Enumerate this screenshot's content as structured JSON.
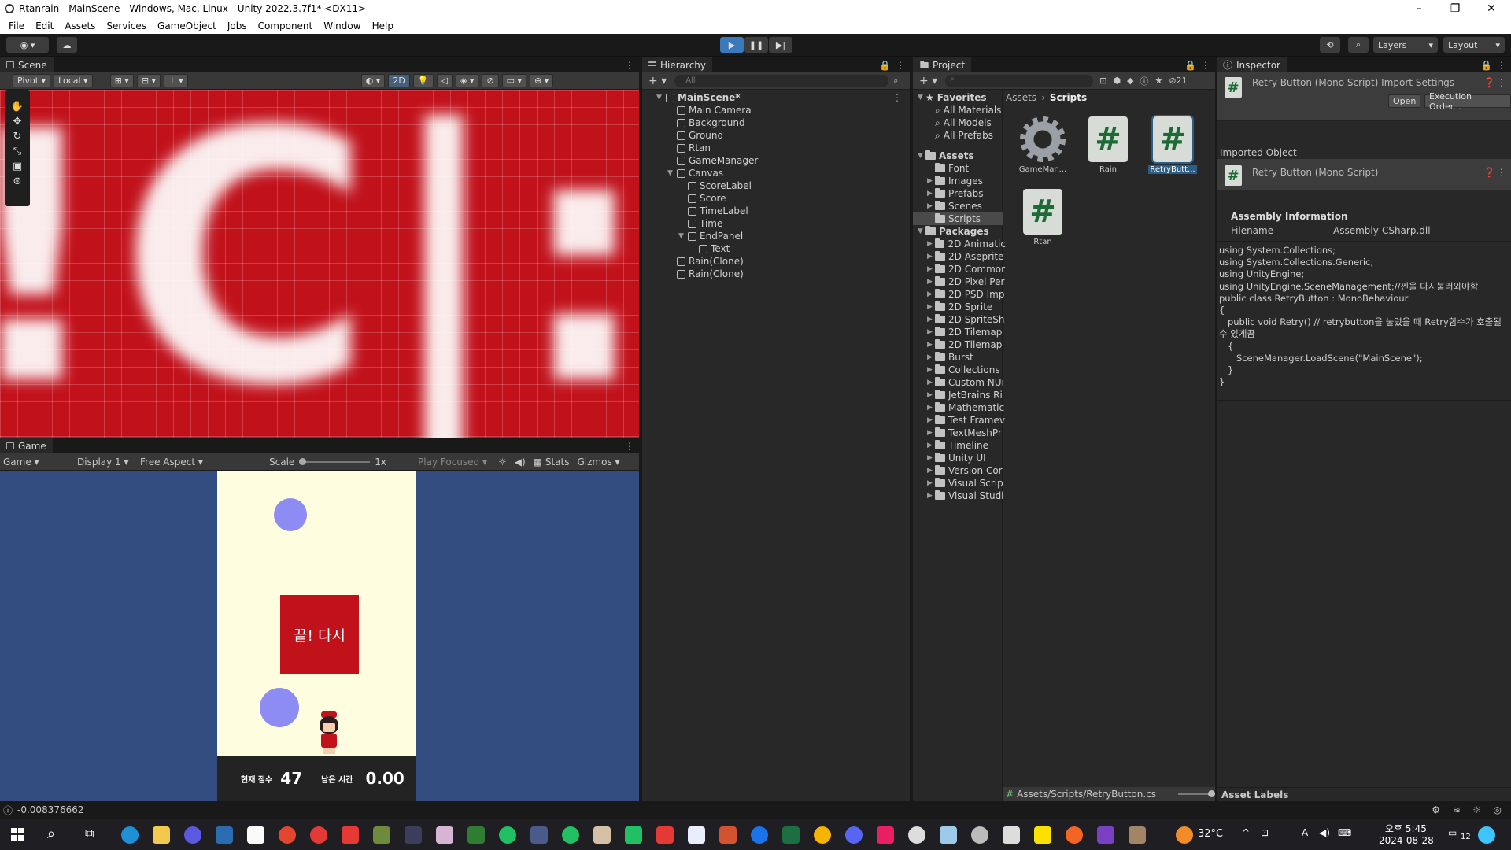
{
  "window": {
    "title": "Rtanrain - MainScene - Windows, Mac, Linux - Unity 2022.3.7f1* <DX11>"
  },
  "menu": [
    "File",
    "Edit",
    "Assets",
    "Services",
    "GameObject",
    "Jobs",
    "Component",
    "Window",
    "Help"
  ],
  "toolbar": {
    "layers_label": "Layers",
    "layout_label": "Layout"
  },
  "scene": {
    "tab": "Scene",
    "pivot": "Pivot",
    "local": "Local",
    "mode2d": "2D",
    "bg_color": "#c1121c",
    "big_text": "!C|:"
  },
  "game": {
    "tab": "Game",
    "display_mode": "Game",
    "display": "Display 1",
    "aspect": "Free Aspect",
    "scale_label": "Scale",
    "scale_value": "1x",
    "play_focused": "Play Focused",
    "stats": "Stats",
    "gizmos": "Gizmos",
    "end_button": "끝! 다시",
    "score_label": "현재 점수",
    "score": "47",
    "time_label": "남은 시간",
    "time": "0.00"
  },
  "hierarchy": {
    "tab": "Hierarchy",
    "search_placeholder": "All",
    "items": [
      {
        "label": "MainScene*",
        "depth": 0,
        "type": "scene"
      },
      {
        "label": "Main Camera",
        "depth": 1
      },
      {
        "label": "Background",
        "depth": 1
      },
      {
        "label": "Ground",
        "depth": 1
      },
      {
        "label": "Rtan",
        "depth": 1
      },
      {
        "label": "GameManager",
        "depth": 1
      },
      {
        "label": "Canvas",
        "depth": 1,
        "expanded": true
      },
      {
        "label": "ScoreLabel",
        "depth": 2
      },
      {
        "label": "Score",
        "depth": 2
      },
      {
        "label": "TimeLabel",
        "depth": 2
      },
      {
        "label": "Time",
        "depth": 2
      },
      {
        "label": "EndPanel",
        "depth": 2,
        "expanded": true
      },
      {
        "label": "Text",
        "depth": 3
      },
      {
        "label": "Rain(Clone)",
        "depth": 1
      },
      {
        "label": "Rain(Clone)",
        "depth": 1
      }
    ]
  },
  "project": {
    "tab": "Project",
    "count": "21",
    "favorites_label": "Favorites",
    "favorites": [
      "All Materials",
      "All Models",
      "All Prefabs"
    ],
    "assets_label": "Assets",
    "assets": [
      "Font",
      "Images",
      "Prefabs",
      "Scenes",
      "Scripts"
    ],
    "packages_label": "Packages",
    "packages": [
      "2D Animatic",
      "2D Aseprite",
      "2D Commor",
      "2D Pixel Per",
      "2D PSD Imp",
      "2D Sprite",
      "2D SpriteSh",
      "2D Tilemap",
      "2D Tilemap",
      "Burst",
      "Collections",
      "Custom NUı",
      "JetBrains Ri",
      "Mathematic",
      "Test Framev",
      "TextMeshPr",
      "Timeline",
      "Unity UI",
      "Version Cor",
      "Visual Scrip",
      "Visual Studi"
    ],
    "breadcrumb": [
      "Assets",
      "Scripts"
    ],
    "files": [
      {
        "name": "GameMan...",
        "icon": "gear-icon"
      },
      {
        "name": "Rain",
        "icon": "script-icon"
      },
      {
        "name": "RetryButt...",
        "icon": "script-icon",
        "selected": true
      },
      {
        "name": "Rtan",
        "icon": "script-icon"
      }
    ],
    "footer_path": "Assets/Scripts/RetryButton.cs"
  },
  "inspector": {
    "tab": "Inspector",
    "header": "Retry Button (Mono Script) Import Settings",
    "open": "Open",
    "execution_order": "Execution Order...",
    "imported_object": "Imported Object",
    "object_name": "Retry Button (Mono Script)",
    "assembly_info": "Assembly Information",
    "filename_label": "Filename",
    "filename": "Assembly-CSharp.dll",
    "code": "using System.Collections;\nusing System.Collections.Generic;\nusing UnityEngine;\nusing UnityEngine.SceneManagement;//씬을 다시불러와야함\npublic class RetryButton : MonoBehaviour\n{\n   public void Retry() // retrybutton을 눌렀을 때 Retry함수가 호출될\n수 있게끔\n   {\n      SceneManager.LoadScene(\"MainScene\");\n   }\n}",
    "asset_labels": "Asset Labels"
  },
  "status": {
    "message": "-0.008376662"
  },
  "taskbar": {
    "weather": "32°C",
    "time": "오후 5:45",
    "date": "2024-08-28",
    "notif": "12"
  }
}
